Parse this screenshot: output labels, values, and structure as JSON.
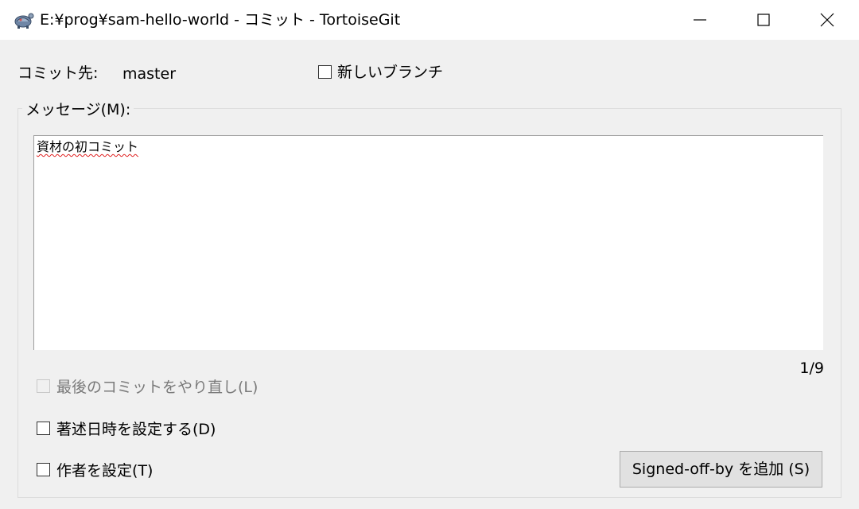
{
  "window": {
    "title": "E:¥prog¥sam-hello-world - コミット - TortoiseGit",
    "icon": "tortoisegit-icon"
  },
  "commit_to": {
    "label": "コミット先:",
    "branch": "master",
    "new_branch_label": "新しいブランチ",
    "new_branch_checked": false
  },
  "message": {
    "group_label": "メッセージ(M):",
    "text": "資材の初コミット",
    "counter": "1/9"
  },
  "options": {
    "amend_label": "最後のコミットをやり直し(L)",
    "amend_enabled": false,
    "set_date_label": "著述日時を設定する(D)",
    "set_author_label": "作者を設定(T)"
  },
  "buttons": {
    "signoff_label": "Signed-off-by を追加 (S)"
  },
  "colors": {
    "background": "#f0f0f0",
    "titlebar": "#ffffff",
    "button_face": "#e1e1e1",
    "spellcheck_underline": "#e02020"
  }
}
